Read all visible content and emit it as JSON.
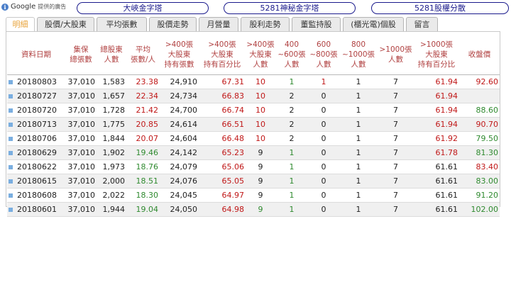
{
  "header": {
    "google_label": "Google",
    "google_sub": "提供的廣告",
    "links": [
      "大峽金字塔",
      "5281神秘金字塔",
      "5281股權分散"
    ]
  },
  "tabs": [
    "明細",
    "股價/大股東",
    "平均張數",
    "股價走勢",
    "月營量",
    "股利走勢",
    "董監持股",
    "(櫃光電)個股",
    "留言"
  ],
  "table": {
    "headers": [
      [
        "資料日期"
      ],
      [
        "集保",
        "總張數"
      ],
      [
        "總股東",
        "人數"
      ],
      [
        "平均",
        "張數/人"
      ],
      [
        ">400張",
        "大股東",
        "持有張數"
      ],
      [
        ">400張",
        "大股東",
        "持有百分比"
      ],
      [
        ">400張",
        "大股東",
        "人數"
      ],
      [
        "400",
        "~600張",
        "人數"
      ],
      [
        "600",
        "~800張",
        "人數"
      ],
      [
        "800",
        "~1000張",
        "人數"
      ],
      [
        ">1000張",
        "人數"
      ],
      [
        ">1000張",
        "大股東",
        "持有百分比"
      ],
      [
        "收盤價"
      ]
    ],
    "rows": [
      [
        "20180803",
        "37,010",
        "1,583",
        "23.38",
        "24,910",
        "67.31",
        "10",
        "1",
        "1",
        "1",
        "7",
        "61.94",
        "92.60"
      ],
      [
        "20180727",
        "37,010",
        "1,657",
        "22.34",
        "24,734",
        "66.83",
        "10",
        "2",
        "0",
        "1",
        "7",
        "61.94",
        ""
      ],
      [
        "20180720",
        "37,010",
        "1,728",
        "21.42",
        "24,700",
        "66.74",
        "10",
        "2",
        "0",
        "1",
        "7",
        "61.94",
        "88.60"
      ],
      [
        "20180713",
        "37,010",
        "1,775",
        "20.85",
        "24,614",
        "66.51",
        "10",
        "2",
        "0",
        "1",
        "7",
        "61.94",
        "90.70"
      ],
      [
        "20180706",
        "37,010",
        "1,844",
        "20.07",
        "24,604",
        "66.48",
        "10",
        "2",
        "0",
        "1",
        "7",
        "61.92",
        "79.50"
      ],
      [
        "20180629",
        "37,010",
        "1,902",
        "19.46",
        "24,142",
        "65.23",
        "9",
        "1",
        "0",
        "1",
        "7",
        "61.78",
        "81.30"
      ],
      [
        "20180622",
        "37,010",
        "1,973",
        "18.76",
        "24,079",
        "65.06",
        "9",
        "1",
        "0",
        "1",
        "7",
        "61.61",
        "83.40"
      ],
      [
        "20180615",
        "37,010",
        "2,000",
        "18.51",
        "24,076",
        "65.05",
        "9",
        "1",
        "0",
        "1",
        "7",
        "61.61",
        "83.00"
      ],
      [
        "20180608",
        "37,010",
        "2,022",
        "18.30",
        "24,045",
        "64.97",
        "9",
        "1",
        "0",
        "1",
        "7",
        "61.61",
        "91.20"
      ],
      [
        "20180601",
        "37,010",
        "1,944",
        "19.04",
        "24,050",
        "64.98",
        "9",
        "1",
        "0",
        "1",
        "7",
        "61.61",
        "102.00"
      ]
    ]
  },
  "colors": {
    "red": "#c01818",
    "green": "#2f8a2f",
    "header_text": "#b04040",
    "pill_border": "#1a1a8c",
    "active_tab": "#e8a33a"
  }
}
